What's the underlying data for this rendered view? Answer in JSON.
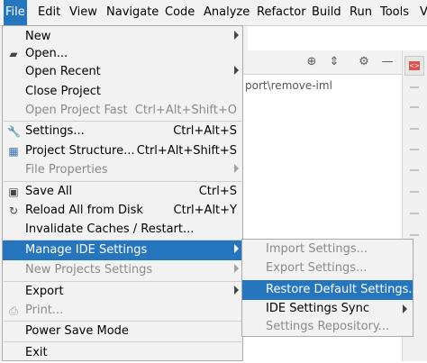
{
  "menubar": {
    "items": [
      "File",
      "Edit",
      "View",
      "Navigate",
      "Code",
      "Analyze",
      "Refactor",
      "Build",
      "Run",
      "Tools",
      "V"
    ]
  },
  "editor": {
    "path_text": "port\\remove-iml"
  },
  "file_menu": {
    "new": "New",
    "open": "Open...",
    "open_recent": "Open Recent",
    "close_project": "Close Project",
    "open_project_fast": "Open Project Fast",
    "open_project_fast_shortcut": "Ctrl+Alt+Shift+O",
    "settings": "Settings...",
    "settings_shortcut": "Ctrl+Alt+S",
    "project_structure": "Project Structure...",
    "project_structure_shortcut": "Ctrl+Alt+Shift+S",
    "file_properties": "File Properties",
    "save_all": "Save All",
    "save_all_shortcut": "Ctrl+S",
    "reload_all": "Reload All from Disk",
    "reload_all_shortcut": "Ctrl+Alt+Y",
    "invalidate_caches": "Invalidate Caches / Restart...",
    "manage_ide_settings": "Manage IDE Settings",
    "new_projects_settings": "New Projects Settings",
    "export": "Export",
    "print": "Print...",
    "power_save_mode": "Power Save Mode",
    "exit": "Exit"
  },
  "submenu": {
    "import_settings": "Import Settings...",
    "export_settings": "Export Settings...",
    "restore_default_settings": "Restore Default Settings...",
    "ide_settings_sync": "IDE Settings Sync",
    "settings_repository": "Settings Repository..."
  },
  "colors": {
    "highlight": "#2675bf",
    "menu_bg": "#f2f2f2",
    "disabled_text": "#8a8a8a"
  }
}
